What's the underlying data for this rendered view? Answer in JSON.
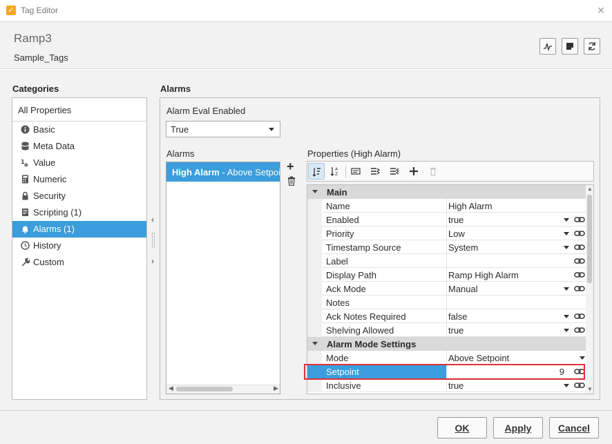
{
  "window": {
    "title": "Tag Editor",
    "close": "×",
    "app_icon": "ignition-icon"
  },
  "header": {
    "tag_name": "Ramp3",
    "tag_path": "Sample_Tags",
    "buttons": [
      "trend-icon",
      "note-icon",
      "refresh-icon"
    ]
  },
  "categories": {
    "title": "Categories",
    "all": "All Properties",
    "items": [
      {
        "label": "Basic",
        "icon": "info-icon"
      },
      {
        "label": "Meta Data",
        "icon": "database-icon"
      },
      {
        "label": "Value",
        "icon": "value-icon"
      },
      {
        "label": "Numeric",
        "icon": "calculator-icon"
      },
      {
        "label": "Security",
        "icon": "lock-icon"
      },
      {
        "label": "Scripting (1)",
        "icon": "script-icon"
      },
      {
        "label": "Alarms (1)",
        "icon": "bell-icon",
        "selected": true
      },
      {
        "label": "History",
        "icon": "clock-icon"
      },
      {
        "label": "Custom",
        "icon": "wrench-icon"
      }
    ]
  },
  "alarms": {
    "title": "Alarms",
    "eval_label": "Alarm Eval Enabled",
    "eval_value": "True",
    "list_label": "Alarms",
    "alarm_name": "High Alarm",
    "alarm_detail": " - Above Setpoint",
    "add": "+",
    "props_label": "Properties (High Alarm)"
  },
  "grid": {
    "groups": [
      "Main",
      "Alarm Mode Settings"
    ],
    "main_rows": [
      {
        "name": "Name",
        "value": "High Alarm",
        "dropdown": false,
        "link": false
      },
      {
        "name": "Enabled",
        "value": "true",
        "dropdown": true,
        "link": true
      },
      {
        "name": "Priority",
        "value": "Low",
        "dropdown": true,
        "link": true
      },
      {
        "name": "Timestamp Source",
        "value": "System",
        "dropdown": true,
        "link": true
      },
      {
        "name": "Label",
        "value": "",
        "dropdown": false,
        "link": true
      },
      {
        "name": "Display Path",
        "value": "Ramp High Alarm",
        "dropdown": false,
        "link": true
      },
      {
        "name": "Ack Mode",
        "value": "Manual",
        "dropdown": true,
        "link": true
      },
      {
        "name": "Notes",
        "value": "",
        "dropdown": false,
        "link": false
      },
      {
        "name": "Ack Notes Required",
        "value": "false",
        "dropdown": true,
        "link": true
      },
      {
        "name": "Shelving Allowed",
        "value": "true",
        "dropdown": true,
        "link": true
      }
    ],
    "mode_rows": [
      {
        "name": "Mode",
        "value": "Above Setpoint",
        "dropdown": true,
        "link": false
      },
      {
        "name": "Setpoint",
        "value": "9",
        "dropdown": false,
        "link": true,
        "selected": true
      },
      {
        "name": "Inclusive",
        "value": "true",
        "dropdown": true,
        "link": true
      }
    ]
  },
  "footer": {
    "ok": "OK",
    "apply": "Apply",
    "cancel": "Cancel"
  },
  "colors": {
    "accent": "#3b9ddb",
    "highlight_border": "#e0323a",
    "panel_bg": "#f2f2f2"
  }
}
